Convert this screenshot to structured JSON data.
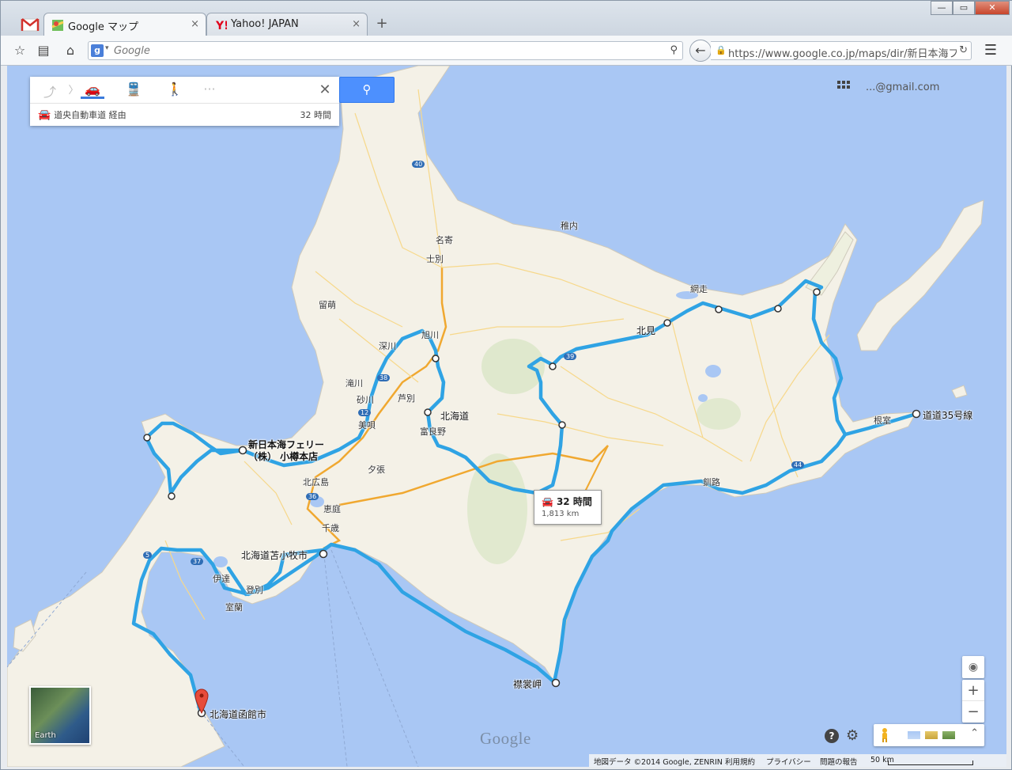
{
  "browser": {
    "tabs": [
      {
        "title": "Google マップ",
        "close": "×"
      },
      {
        "title": "Yahoo! JAPAN",
        "close": "×"
      }
    ],
    "new_tab": "+",
    "search_placeholder": "Google",
    "url": "https://www.google.co.jp/maps/dir/新日本海フ",
    "window_controls": {
      "minimize": "—",
      "maximize": "▭",
      "close": "✕"
    }
  },
  "directions": {
    "modes": [
      "drive",
      "transit",
      "walk",
      "more"
    ],
    "selected_mode": "drive",
    "more_label": "···",
    "route_via": "道央自動車道 経由",
    "route_time": "32 時間"
  },
  "account": {
    "email": "...@gmail.com"
  },
  "route_bubble": {
    "time": "32 時間",
    "distance": "1,813 km"
  },
  "places": {
    "ferry": "新日本海フェリー\n（株） 小樽本店",
    "hokkaido": "北海道",
    "tomakomai": "北海道苫小牧市",
    "hakodate": "北海道函館市",
    "erimo": "襟裳岬",
    "douro35": "道道35号線"
  },
  "towns": [
    "稚内",
    "名寄",
    "士別",
    "旭川",
    "深川",
    "滝川",
    "砂川",
    "美唄",
    "芦別",
    "富良野",
    "夕張",
    "北広島",
    "恵庭",
    "千歳",
    "留萌",
    "伊達",
    "室蘭",
    "登別",
    "北見",
    "網走",
    "根室",
    "釧路"
  ],
  "road_numbers": [
    "40",
    "39",
    "38",
    "12",
    "36",
    "37",
    "5",
    "44"
  ],
  "earth_label": "Earth",
  "google_logo": "Google",
  "footer": {
    "copyright": "地図データ ©2014 Google, ZENRIN",
    "terms": "利用規約",
    "privacy": "プライバシー",
    "report": "問題の報告",
    "scale": "50 km"
  },
  "colors": {
    "water": "#a9c7f4",
    "land": "#f4f1e7",
    "route": "#2fa3e4",
    "highway": "#f0a830",
    "search_button": "#4d90fe"
  }
}
